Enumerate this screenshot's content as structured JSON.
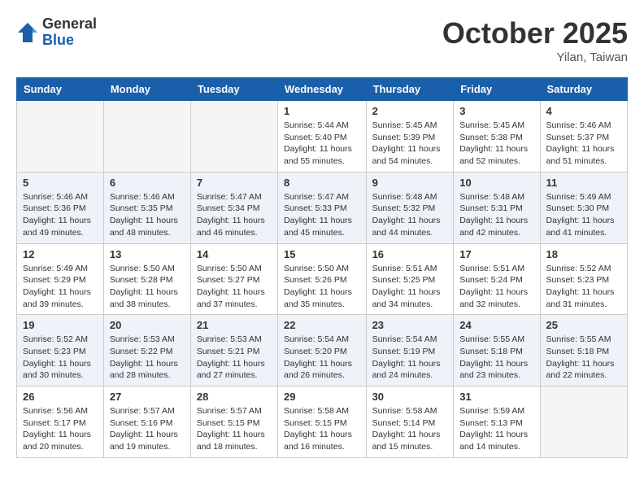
{
  "header": {
    "logo_general": "General",
    "logo_blue": "Blue",
    "month_title": "October 2025",
    "location": "Yilan, Taiwan"
  },
  "days_of_week": [
    "Sunday",
    "Monday",
    "Tuesday",
    "Wednesday",
    "Thursday",
    "Friday",
    "Saturday"
  ],
  "weeks": [
    [
      {
        "day": "",
        "info": ""
      },
      {
        "day": "",
        "info": ""
      },
      {
        "day": "",
        "info": ""
      },
      {
        "day": "1",
        "info": "Sunrise: 5:44 AM\nSunset: 5:40 PM\nDaylight: 11 hours\nand 55 minutes."
      },
      {
        "day": "2",
        "info": "Sunrise: 5:45 AM\nSunset: 5:39 PM\nDaylight: 11 hours\nand 54 minutes."
      },
      {
        "day": "3",
        "info": "Sunrise: 5:45 AM\nSunset: 5:38 PM\nDaylight: 11 hours\nand 52 minutes."
      },
      {
        "day": "4",
        "info": "Sunrise: 5:46 AM\nSunset: 5:37 PM\nDaylight: 11 hours\nand 51 minutes."
      }
    ],
    [
      {
        "day": "5",
        "info": "Sunrise: 5:46 AM\nSunset: 5:36 PM\nDaylight: 11 hours\nand 49 minutes."
      },
      {
        "day": "6",
        "info": "Sunrise: 5:46 AM\nSunset: 5:35 PM\nDaylight: 11 hours\nand 48 minutes."
      },
      {
        "day": "7",
        "info": "Sunrise: 5:47 AM\nSunset: 5:34 PM\nDaylight: 11 hours\nand 46 minutes."
      },
      {
        "day": "8",
        "info": "Sunrise: 5:47 AM\nSunset: 5:33 PM\nDaylight: 11 hours\nand 45 minutes."
      },
      {
        "day": "9",
        "info": "Sunrise: 5:48 AM\nSunset: 5:32 PM\nDaylight: 11 hours\nand 44 minutes."
      },
      {
        "day": "10",
        "info": "Sunrise: 5:48 AM\nSunset: 5:31 PM\nDaylight: 11 hours\nand 42 minutes."
      },
      {
        "day": "11",
        "info": "Sunrise: 5:49 AM\nSunset: 5:30 PM\nDaylight: 11 hours\nand 41 minutes."
      }
    ],
    [
      {
        "day": "12",
        "info": "Sunrise: 5:49 AM\nSunset: 5:29 PM\nDaylight: 11 hours\nand 39 minutes."
      },
      {
        "day": "13",
        "info": "Sunrise: 5:50 AM\nSunset: 5:28 PM\nDaylight: 11 hours\nand 38 minutes."
      },
      {
        "day": "14",
        "info": "Sunrise: 5:50 AM\nSunset: 5:27 PM\nDaylight: 11 hours\nand 37 minutes."
      },
      {
        "day": "15",
        "info": "Sunrise: 5:50 AM\nSunset: 5:26 PM\nDaylight: 11 hours\nand 35 minutes."
      },
      {
        "day": "16",
        "info": "Sunrise: 5:51 AM\nSunset: 5:25 PM\nDaylight: 11 hours\nand 34 minutes."
      },
      {
        "day": "17",
        "info": "Sunrise: 5:51 AM\nSunset: 5:24 PM\nDaylight: 11 hours\nand 32 minutes."
      },
      {
        "day": "18",
        "info": "Sunrise: 5:52 AM\nSunset: 5:23 PM\nDaylight: 11 hours\nand 31 minutes."
      }
    ],
    [
      {
        "day": "19",
        "info": "Sunrise: 5:52 AM\nSunset: 5:23 PM\nDaylight: 11 hours\nand 30 minutes."
      },
      {
        "day": "20",
        "info": "Sunrise: 5:53 AM\nSunset: 5:22 PM\nDaylight: 11 hours\nand 28 minutes."
      },
      {
        "day": "21",
        "info": "Sunrise: 5:53 AM\nSunset: 5:21 PM\nDaylight: 11 hours\nand 27 minutes."
      },
      {
        "day": "22",
        "info": "Sunrise: 5:54 AM\nSunset: 5:20 PM\nDaylight: 11 hours\nand 26 minutes."
      },
      {
        "day": "23",
        "info": "Sunrise: 5:54 AM\nSunset: 5:19 PM\nDaylight: 11 hours\nand 24 minutes."
      },
      {
        "day": "24",
        "info": "Sunrise: 5:55 AM\nSunset: 5:18 PM\nDaylight: 11 hours\nand 23 minutes."
      },
      {
        "day": "25",
        "info": "Sunrise: 5:55 AM\nSunset: 5:18 PM\nDaylight: 11 hours\nand 22 minutes."
      }
    ],
    [
      {
        "day": "26",
        "info": "Sunrise: 5:56 AM\nSunset: 5:17 PM\nDaylight: 11 hours\nand 20 minutes."
      },
      {
        "day": "27",
        "info": "Sunrise: 5:57 AM\nSunset: 5:16 PM\nDaylight: 11 hours\nand 19 minutes."
      },
      {
        "day": "28",
        "info": "Sunrise: 5:57 AM\nSunset: 5:15 PM\nDaylight: 11 hours\nand 18 minutes."
      },
      {
        "day": "29",
        "info": "Sunrise: 5:58 AM\nSunset: 5:15 PM\nDaylight: 11 hours\nand 16 minutes."
      },
      {
        "day": "30",
        "info": "Sunrise: 5:58 AM\nSunset: 5:14 PM\nDaylight: 11 hours\nand 15 minutes."
      },
      {
        "day": "31",
        "info": "Sunrise: 5:59 AM\nSunset: 5:13 PM\nDaylight: 11 hours\nand 14 minutes."
      },
      {
        "day": "",
        "info": ""
      }
    ]
  ]
}
